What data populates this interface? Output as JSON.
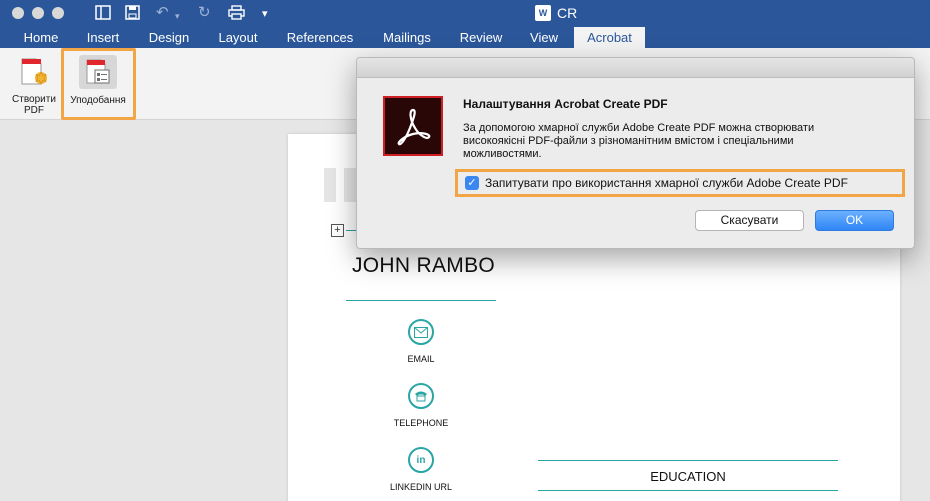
{
  "window": {
    "doc_title": "CR",
    "doc_icon": "W"
  },
  "tabs": [
    {
      "label": "Home"
    },
    {
      "label": "Insert"
    },
    {
      "label": "Design"
    },
    {
      "label": "Layout"
    },
    {
      "label": "References"
    },
    {
      "label": "Mailings"
    },
    {
      "label": "Review"
    },
    {
      "label": "View"
    },
    {
      "label": "Acrobat",
      "active": true
    }
  ],
  "ribbon": {
    "create_pdf_label_line1": "Створити",
    "create_pdf_label_line2": "PDF",
    "preferences_label": "Уподобання"
  },
  "document": {
    "name": "JOHN RAMBO",
    "contacts": [
      {
        "label": "EMAIL",
        "icon": "envelope-icon"
      },
      {
        "label": "TELEPHONE",
        "icon": "telephone-icon"
      },
      {
        "label": "LINKEDIN URL",
        "icon": "linkedin-icon"
      }
    ],
    "section_education": "EDUCATION",
    "add_symbol": "+"
  },
  "dialog": {
    "heading": "Налаштування Acrobat Create PDF",
    "body": "За допомогою хмарної служби Adobe Create PDF можна створювати високоякісні PDF-файли з різноманітним вмістом і спеціальними можливостями.",
    "checkbox_label": "Запитувати про використання хмарної служби Adobe Create PDF",
    "checkbox_checked": true,
    "cancel_label": "Скасувати",
    "ok_label": "OK"
  },
  "colors": {
    "word_blue": "#2b579a",
    "highlight_orange": "#f3a545",
    "resume_teal": "#2aa5a4",
    "acrobat_red": "#d01e25",
    "ok_blue": "#2f86f5"
  }
}
